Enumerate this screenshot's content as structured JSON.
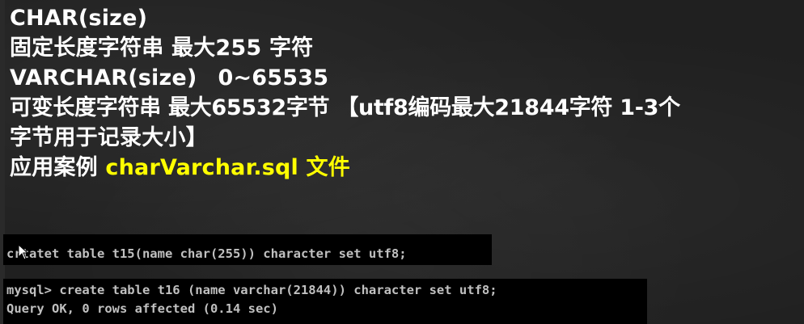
{
  "slide": {
    "line1": "CHAR(size)",
    "line2": "固定长度字符串 最大255 字符",
    "line3_a": "VARCHAR(size)",
    "line3_b": "0~65535",
    "line4": "可变长度字符串 最大65532字节  【utf8编码最大21844字符 1-3个",
    "line5": "字节用于记录大小】",
    "line6_prefix": "应用案例 ",
    "line6_highlight": "charVarchar.sql 文件"
  },
  "terminal1": {
    "line": "crtatet table t15(name char(255)) character set utf8;"
  },
  "terminal2": {
    "line1": "mysql> create table t16 (name varchar(21844)) character set utf8;",
    "line2": "Query OK, 0 rows affected (0.14 sec)"
  },
  "colors": {
    "text": "#ffffff",
    "highlight": "#ffff00",
    "terminal_bg": "#000000",
    "terminal_text": "#c0c0c0"
  },
  "icons": {
    "cursor": "mouse-pointer-icon"
  }
}
